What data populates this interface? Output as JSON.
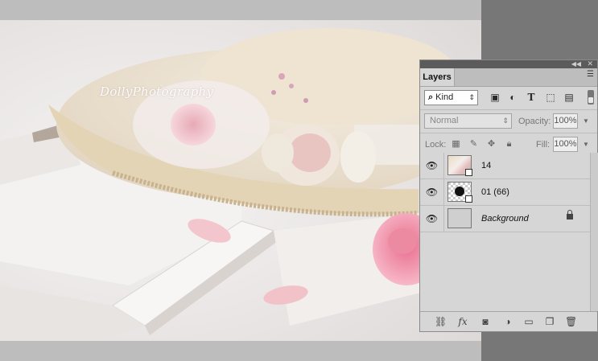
{
  "canvas": {
    "watermark": "DollyPhotography"
  },
  "layers_panel": {
    "tab": "Layers",
    "collapse_icon": "double-chevron-left-icon",
    "close_icon": "close-icon",
    "menu_icon": "panel-menu-icon",
    "filter": {
      "search_glyph": "⌕",
      "kind_label": "Kind",
      "icons": [
        "pixel-filter-icon",
        "adjustment-filter-icon",
        "type-filter-icon",
        "shape-filter-icon",
        "smart-object-filter-icon"
      ]
    },
    "blend_mode": "Normal",
    "opacity_label": "Opacity:",
    "opacity_value": "100%",
    "lock_label": "Lock:",
    "fill_label": "Fill:",
    "fill_value": "100%",
    "layers": [
      {
        "name": "14",
        "visible": true,
        "smart_object": true,
        "locked": false
      },
      {
        "name": "01 (66)",
        "visible": true,
        "smart_object": true,
        "locked": false
      },
      {
        "name": "Background",
        "visible": true,
        "smart_object": false,
        "locked": true
      }
    ],
    "footer_icons": [
      "link-layers-icon",
      "fx-icon",
      "mask-icon",
      "adjustment-layer-icon",
      "new-group-folder-icon",
      "new-layer-icon",
      "trash-icon"
    ]
  },
  "colors": {
    "panel_bg": "#d6d6d6",
    "pasteboard": "#bdbdbd",
    "workspace": "#6f6f6f"
  }
}
